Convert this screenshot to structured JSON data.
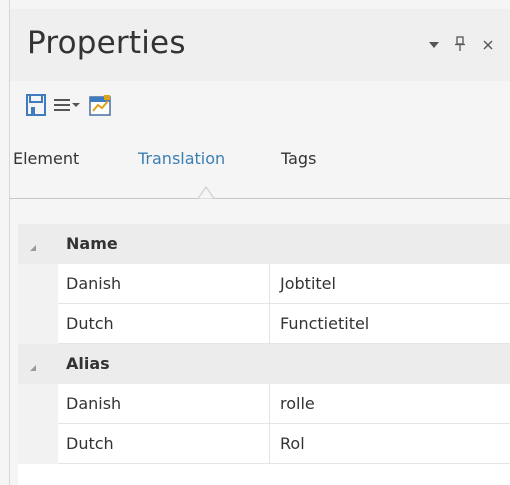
{
  "panel": {
    "title": "Properties",
    "title_icons": [
      "dropdown-arrow-icon",
      "pin-icon",
      "close-icon"
    ]
  },
  "toolbar": {
    "items": [
      "save-icon",
      "menu-icon",
      "dropdown-arrow-icon",
      "properties-icon"
    ]
  },
  "tabs": [
    {
      "label": "Element",
      "active": false
    },
    {
      "label": "Translation",
      "active": true
    },
    {
      "label": "Tags",
      "active": false
    }
  ],
  "groups": [
    {
      "name": "Name",
      "rows": [
        {
          "key": "Danish",
          "value": "Jobtitel"
        },
        {
          "key": "Dutch",
          "value": "Functietitel"
        }
      ]
    },
    {
      "name": "Alias",
      "rows": [
        {
          "key": "Danish",
          "value": "rolle"
        },
        {
          "key": "Dutch",
          "value": "Rol"
        }
      ]
    }
  ],
  "colors": {
    "accent": "#3c7fb1",
    "save_icon": "#3e7bbf"
  }
}
